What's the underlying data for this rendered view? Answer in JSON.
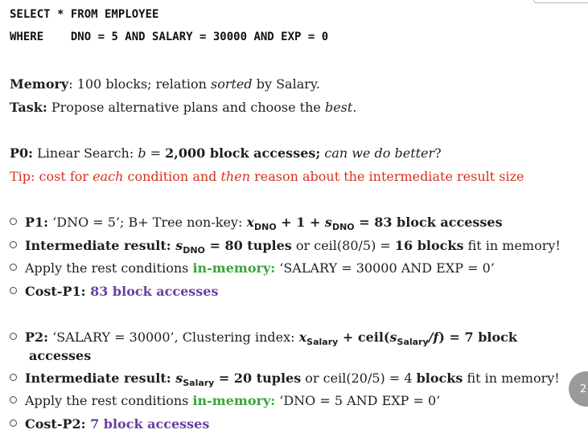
{
  "sql": {
    "line1": "SELECT * FROM EMPLOYEE",
    "where_kw": "WHERE",
    "where_clause": "DNO = 5 AND SALARY = 30000 AND EXP = 0"
  },
  "memory": {
    "label": "Memory",
    "pre": ": 100 blocks; relation ",
    "sorted": "sorted",
    "post": " by Salary."
  },
  "task": {
    "label": "Task:",
    "pre": " Propose alternative plans and choose the ",
    "best": "best",
    "post": "."
  },
  "p0": {
    "label": "P0:",
    "pre": " Linear Search: ",
    "b": "b",
    "eq": " = ",
    "cost": "2,000 block accesses;",
    "question": " can we do better",
    "qmark": "?"
  },
  "tip": {
    "pre": "Tip: cost for ",
    "each": "each",
    "mid": " condition and ",
    "then": "then",
    "post": " reason about the intermediate result size"
  },
  "p1": {
    "b1_label": "P1:",
    "b1_text": " ‘DNO = 5’; B+ Tree non-key: ",
    "b1_x": "x",
    "b1_sub1": "DNO",
    "b1_plus": " + 1 + ",
    "b1_s": "s",
    "b1_sub2": "DNO",
    "b1_result": " = 83 block accesses",
    "b2_label": "Intermediate result: ",
    "b2_s": "s",
    "b2_sub": "DNO",
    "b2_tuples": " = 80 tuples",
    "b2_mid": " or ceil(80/5) = ",
    "b2_blocks": "16 blocks",
    "b2_post": " fit in memory!",
    "b3_pre": "Apply the rest conditions ",
    "b3_green": "in-memory:",
    "b3_post": " ‘SALARY = 30000 AND EXP = 0’",
    "b4_label": "Cost-P1:",
    "b4_value": " 83 block accesses"
  },
  "p2": {
    "b1_label": "P2:",
    "b1_text": " ‘SALARY = 30000’, Clustering index: ",
    "b1_x": "x",
    "b1_sub1": "Salary",
    "b1_plus": " + ceil(",
    "b1_s": "s",
    "b1_sub2": "Salary",
    "b1_f": "/f",
    "b1_result": ") = 7 block",
    "b1_cont": "accesses",
    "b2_label": "Intermediate result: ",
    "b2_s": "s",
    "b2_sub": "Salary",
    "b2_tuples": " = 20 tuples",
    "b2_mid": " or ceil(20/5) = 4 ",
    "b2_blocks": "blocks",
    "b2_post": " fit in memory!",
    "b3_pre": "Apply the rest conditions ",
    "b3_green": "in-memory:",
    "b3_post": " ‘DNO = 5 AND EXP = 0’",
    "b4_label": "Cost-P2:",
    "b4_value": " 7 block accesses"
  },
  "page_number": "2",
  "colors": {
    "tip": "#d5321f",
    "green": "#3aa53a",
    "purple": "#6b3fa0"
  }
}
